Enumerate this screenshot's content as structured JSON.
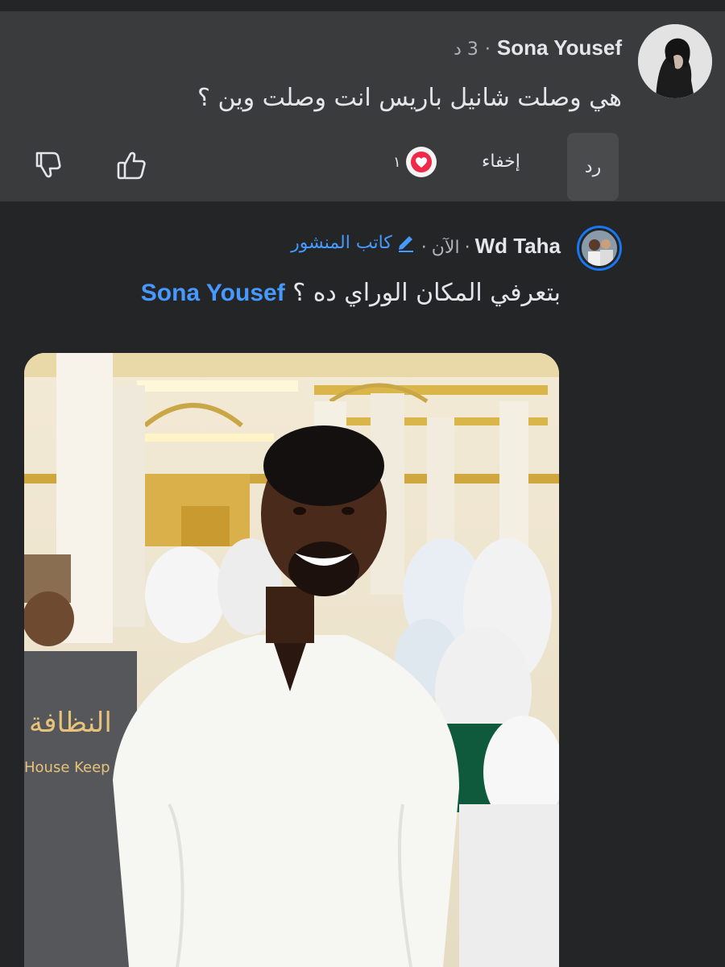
{
  "comment1": {
    "author": "Sona Yousef",
    "time": "3 د",
    "text": "هي وصلت شانيل باريس  انت وصلت وين ؟",
    "actions": {
      "reply": "رد",
      "hide": "إخفاء",
      "reaction_count": "١"
    },
    "icons": [
      "avatar",
      "heart-reaction-icon",
      "like-icon",
      "dislike-icon"
    ]
  },
  "comment2": {
    "author": "Wd Taha",
    "time": "الآن",
    "author_badge": "كاتب المنشور",
    "text": "بتعرفي المكان الوراي ده ؟",
    "mention": "Sona Yousef",
    "icons": [
      "avatar",
      "pencil-icon",
      "attached-photo"
    ]
  },
  "photo": {
    "vest_text_ar": "النظافة",
    "vest_text_en": "House Keep"
  },
  "colors": {
    "background": "#242526",
    "highlight_comment": "#3a3b3c",
    "accent": "#4599ff",
    "heart": "#f02849"
  }
}
